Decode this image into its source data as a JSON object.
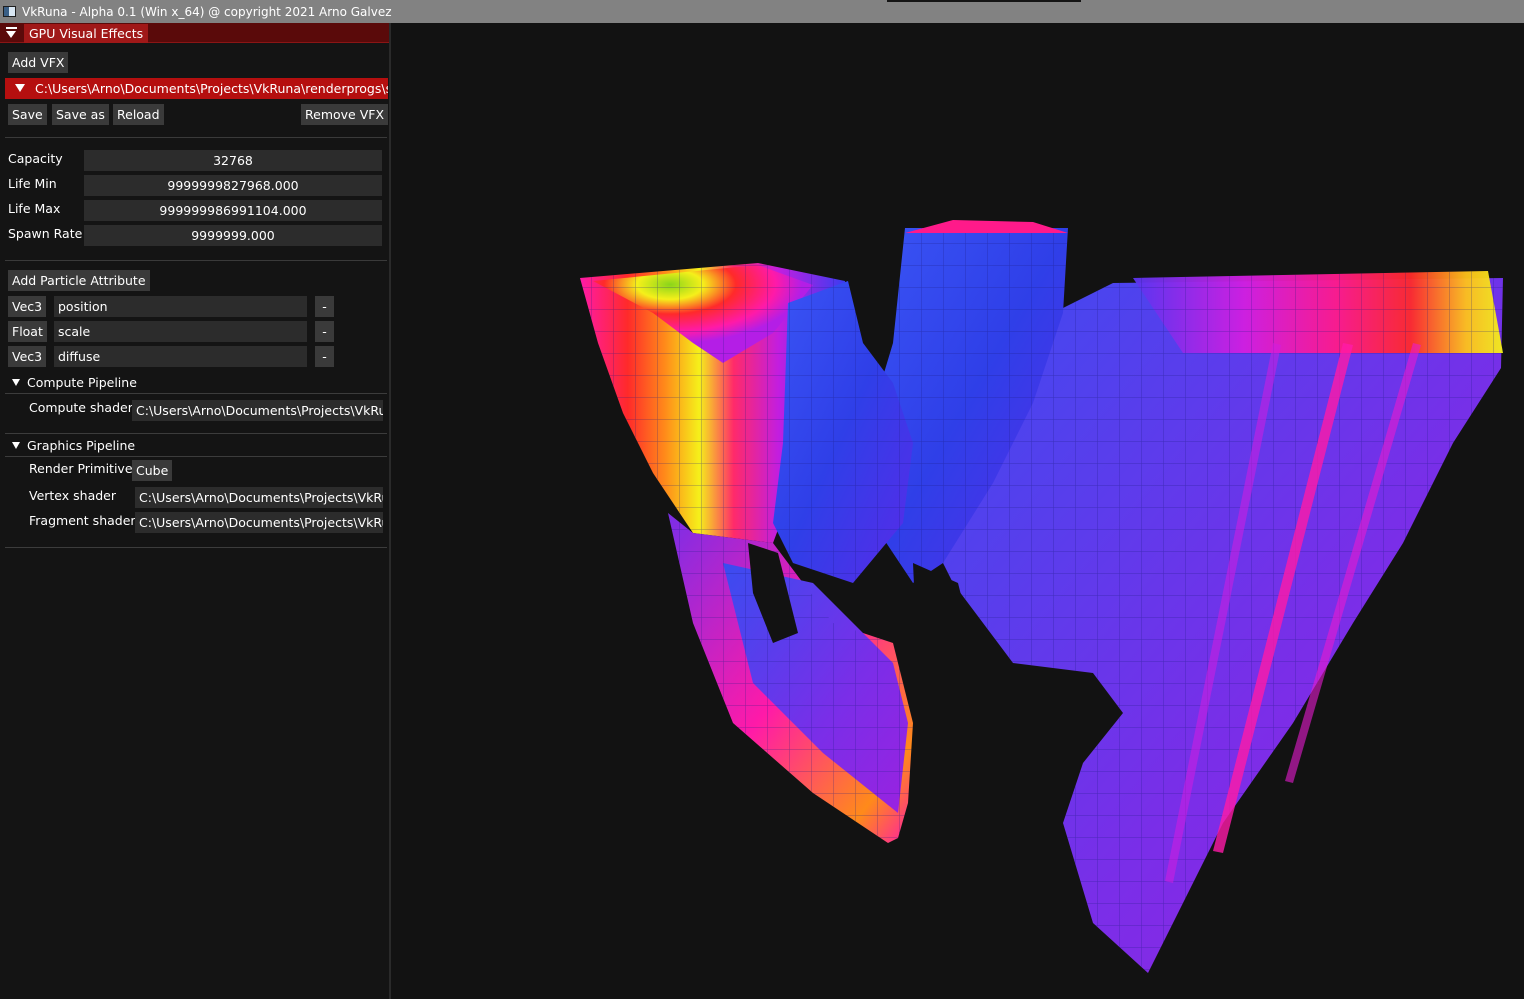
{
  "window": {
    "title": "VkRuna - Alpha 0.1 (Win x_64) @ copyright 2021 Arno Galvez"
  },
  "panel": {
    "header_title": "GPU Visual Effects",
    "add_vfx_label": "Add VFX",
    "vfx_path": "C:\\Users\\Arno\\Documents\\Projects\\VkRuna\\renderprogs\\sam",
    "save_label": "Save",
    "save_as_label": "Save as",
    "reload_label": "Reload",
    "remove_vfx_label": "Remove VFX",
    "params": [
      {
        "label": "Capacity",
        "value": "32768"
      },
      {
        "label": "Life Min",
        "value": "9999999827968.000"
      },
      {
        "label": "Life Max",
        "value": "999999986991104.000"
      },
      {
        "label": "Spawn Rate",
        "value": "9999999.000"
      }
    ],
    "add_attribute_label": "Add Particle Attribute",
    "attributes": [
      {
        "type": "Vec3",
        "name": "position",
        "remove": "-"
      },
      {
        "type": "Float",
        "name": "scale",
        "remove": "-"
      },
      {
        "type": "Vec3",
        "name": "diffuse",
        "remove": "-"
      }
    ],
    "compute_pipeline": {
      "header": "Compute Pipeline",
      "shader_label": "Compute shader",
      "shader_path": "C:\\Users\\Arno\\Documents\\Projects\\VkRun"
    },
    "graphics_pipeline": {
      "header": "Graphics Pipeline",
      "primitive_label": "Render Primitive",
      "primitive_value": "Cube",
      "vertex_label": "Vertex shader",
      "vertex_path": "C:\\Users\\Arno\\Documents\\Projects\\VkRun",
      "fragment_label": "Fragment shader",
      "fragment_path": "C:\\Users\\Arno\\Documents\\Projects\\VkRun"
    }
  },
  "colors": {
    "accent_red": "#b50f0f",
    "particle_blue": "#2f4cf0",
    "particle_purple": "#8a2be2",
    "particle_magenta": "#ff1aa8",
    "particle_red": "#ff2a2a",
    "particle_yellow": "#f5f01a",
    "particle_green": "#8ad51a"
  }
}
